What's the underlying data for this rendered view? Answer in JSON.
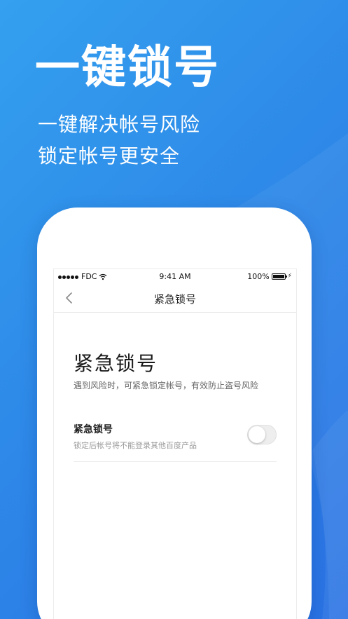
{
  "promo": {
    "headline": "一键锁号",
    "subline_1": "一键解决帐号风险",
    "subline_2": "锁定帐号更安全"
  },
  "status_bar": {
    "carrier": "FDC",
    "time": "9:41 AM",
    "battery": "100%"
  },
  "nav": {
    "back_icon": "chevron-left-icon",
    "title": "紧急锁号"
  },
  "content": {
    "heading": "紧急锁号",
    "description": "遇到风险时，可紧急锁定帐号，有效防止盗号风险",
    "setting": {
      "label": "紧急锁号",
      "hint": "锁定后帐号将不能登录其他百度产品",
      "enabled": false
    }
  },
  "colors": {
    "background_start": "#34a0ef",
    "background_end": "#2a72e4",
    "card": "#ffffff",
    "toggle_off": "#eeeeee"
  }
}
